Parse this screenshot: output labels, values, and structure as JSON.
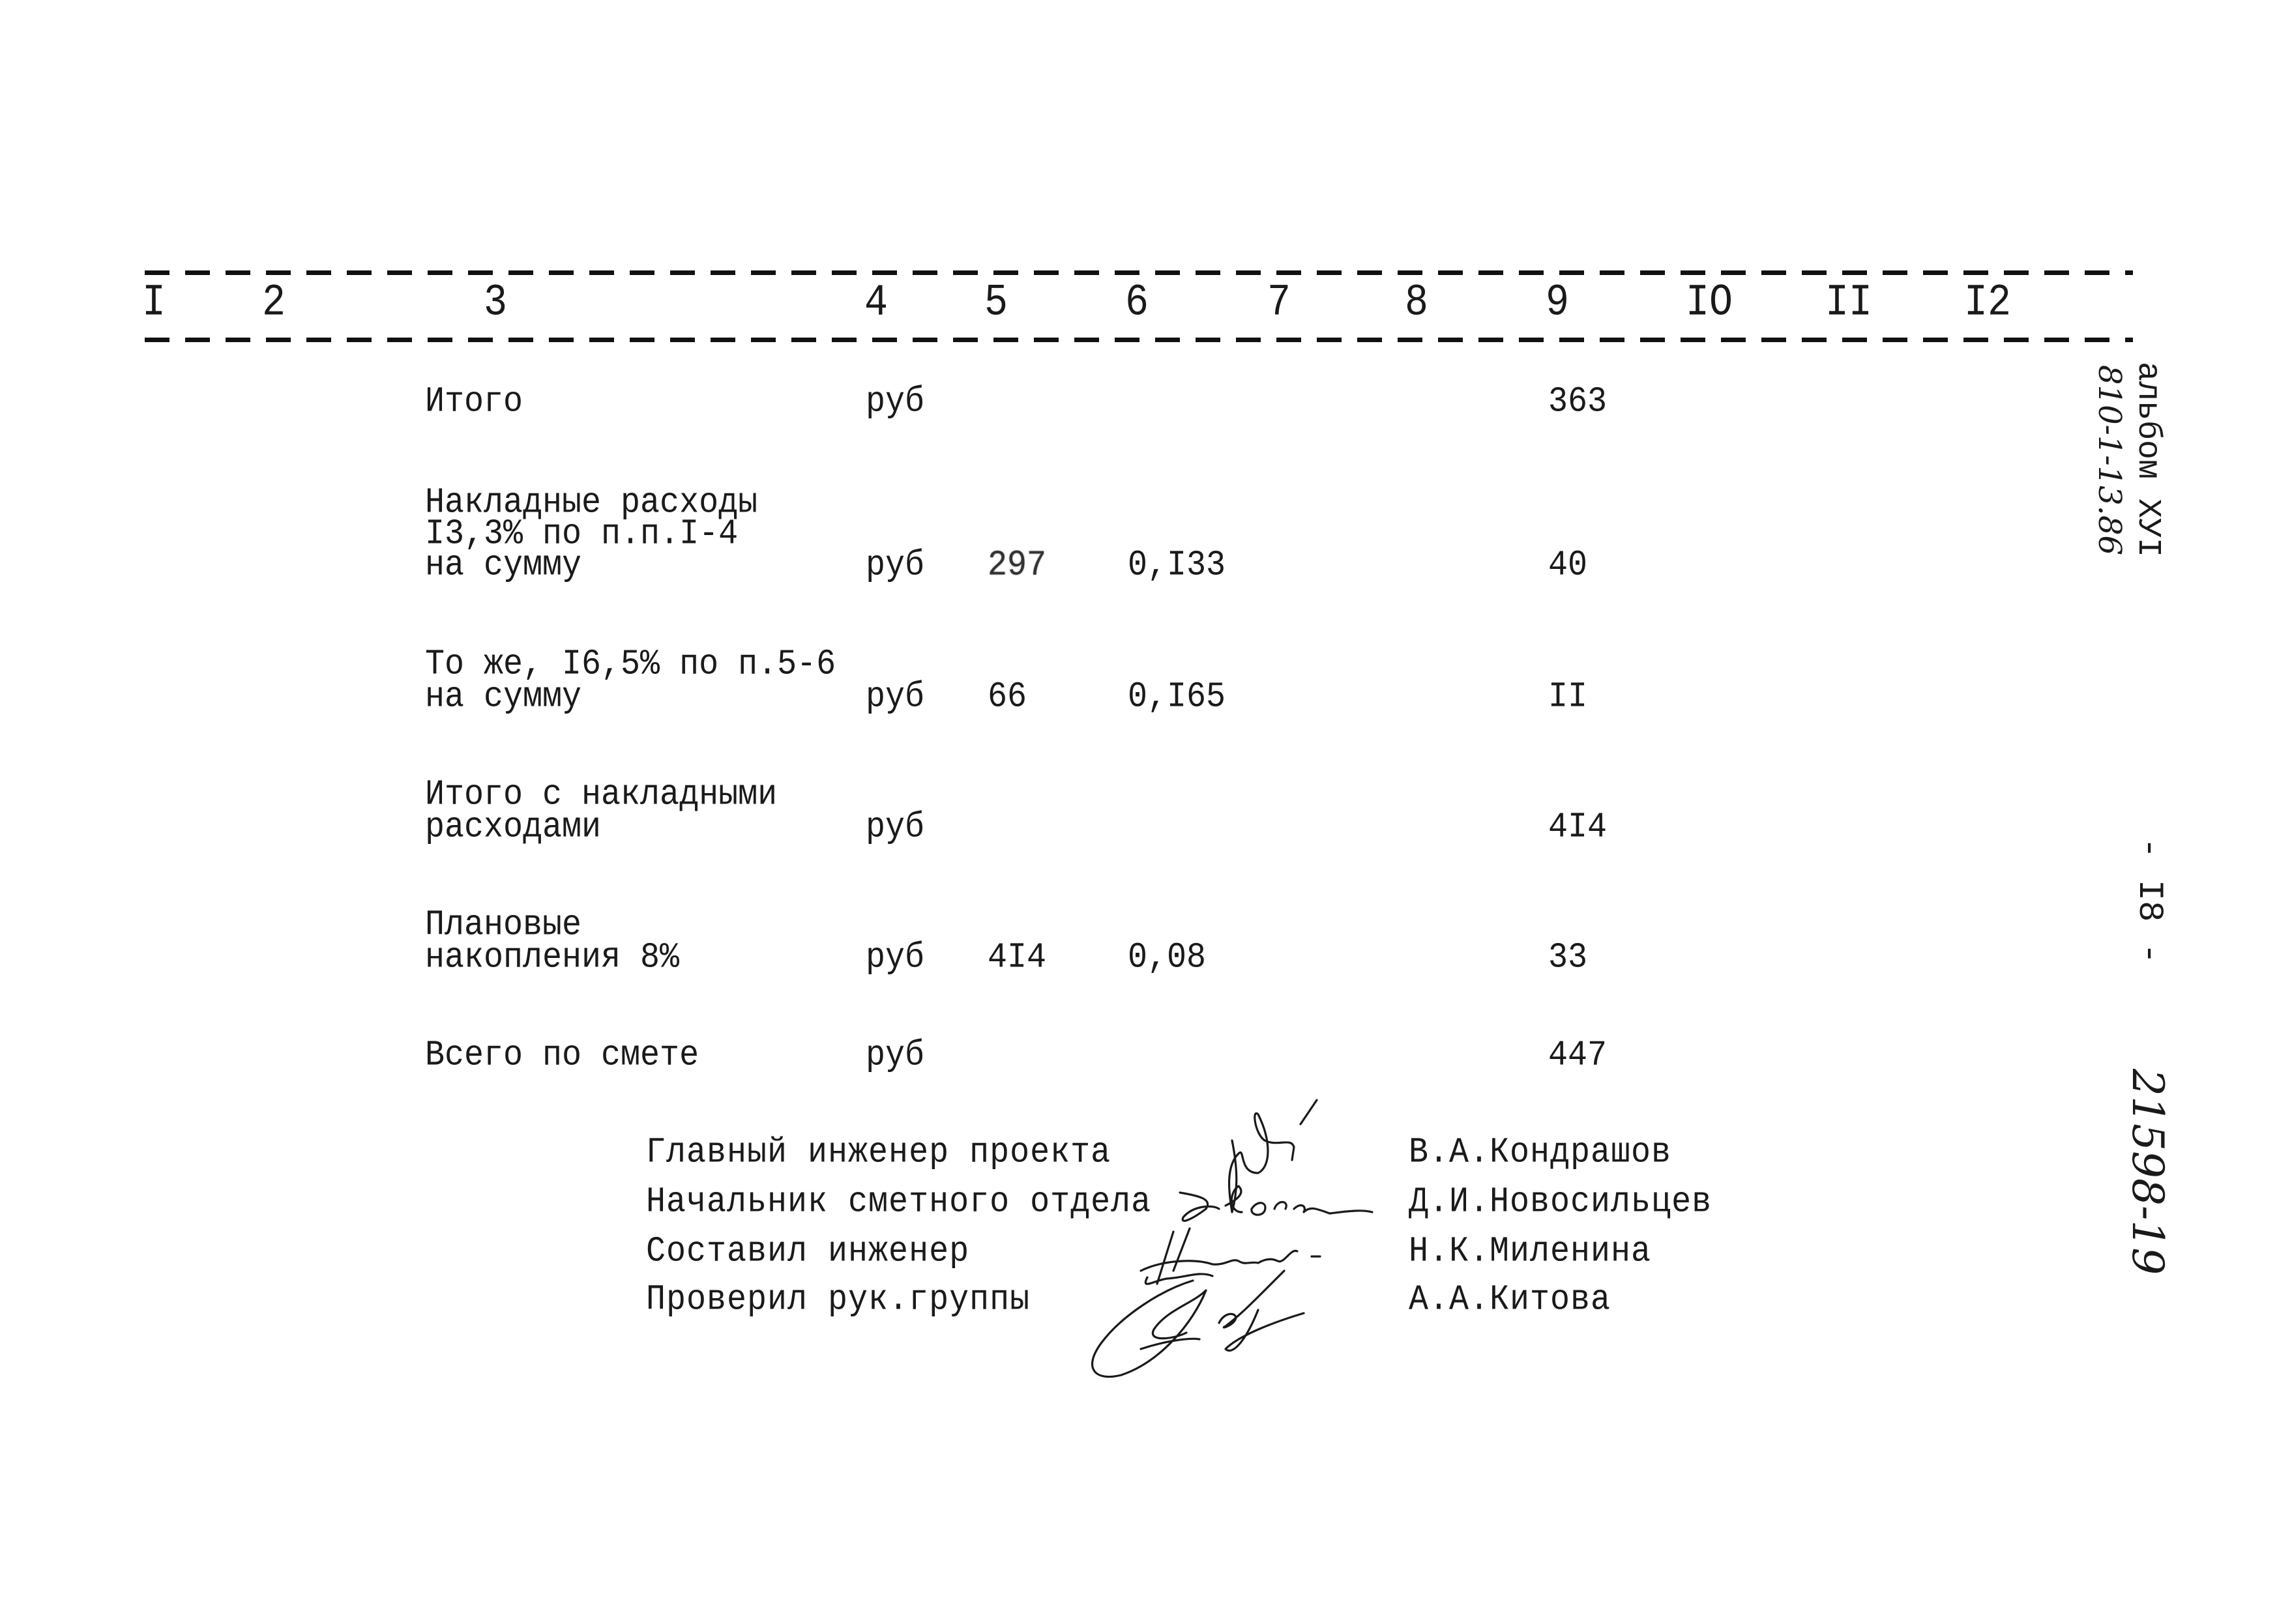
{
  "table_header": {
    "columns": [
      "I",
      "2",
      "3",
      "4",
      "5",
      "6",
      "7",
      "8",
      "9",
      "IO",
      "II",
      "I2"
    ]
  },
  "rows": [
    {
      "description": [
        "Итого"
      ],
      "unit": "руб",
      "col5": "",
      "col6": "",
      "col9": "363"
    },
    {
      "description": [
        "Накладные расходы",
        "I3,3% по п.п.I-4",
        "на сумму"
      ],
      "unit": "руб",
      "col5": "297",
      "col6": "0,I33",
      "col9": "40"
    },
    {
      "description": [
        "То же, I6,5% по п.5-6",
        "на сумму"
      ],
      "unit": "руб",
      "col5": "66",
      "col6": "0,I65",
      "col9": "II"
    },
    {
      "description": [
        "Итого с накладными",
        "расходами"
      ],
      "unit": "руб",
      "col5": "",
      "col6": "",
      "col9": "4I4"
    },
    {
      "description": [
        "Плановые",
        "накопления 8%"
      ],
      "unit": "руб",
      "col5": "4I4",
      "col6": "0,08",
      "col9": "33"
    },
    {
      "description": [
        "Всего по смете"
      ],
      "unit": "руб",
      "col5": "",
      "col6": "",
      "col9": "447"
    }
  ],
  "signatures": [
    {
      "role": "Главный инженер проекта",
      "name": "В.А.Кондрашов"
    },
    {
      "role": "Начальник сметного отдела",
      "name": "Д.И.Новосильцев"
    },
    {
      "role": "Составил инженер",
      "name": "Н.К.Миленина"
    },
    {
      "role": "Проверил рук.группы",
      "name": "А.А.Китова"
    }
  ],
  "margin": {
    "album_label": "альбом XУI",
    "album_code": "810-1-13.86",
    "page_number": "- I8 -",
    "document_number": "21598-19"
  }
}
